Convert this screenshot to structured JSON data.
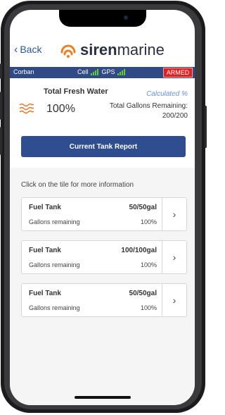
{
  "header": {
    "back_label": "Back",
    "logo_siren": "siren",
    "logo_marine": "marine"
  },
  "status": {
    "vessel_name": "Corban",
    "cell_label": "Cell",
    "gps_label": "GPS",
    "armed_label": "ARMED"
  },
  "water": {
    "title": "Total Fresh Water",
    "percent": "100%",
    "calculated_label": "Calculated %",
    "gallons_label": "Total Gallons Remaining:",
    "gallons_value": "200/200"
  },
  "report": {
    "button_label": "Current Tank Report"
  },
  "tiles_hint": "Click on the tile for more information",
  "tanks": [
    {
      "name": "Fuel Tank",
      "capacity": "50/50gal",
      "sub_label": "Gallons remaining",
      "percent": "100%"
    },
    {
      "name": "Fuel Tank",
      "capacity": "100/100gal",
      "sub_label": "Gallons remaining",
      "percent": "100%"
    },
    {
      "name": "Fuel Tank",
      "capacity": "50/50gal",
      "sub_label": "Gallons remaining",
      "percent": "100%"
    }
  ],
  "colors": {
    "accent_blue": "#2f4e8f",
    "logo_orange": "#f07e1f",
    "signal_green": "#66cc33",
    "armed_red": "#e02020"
  }
}
